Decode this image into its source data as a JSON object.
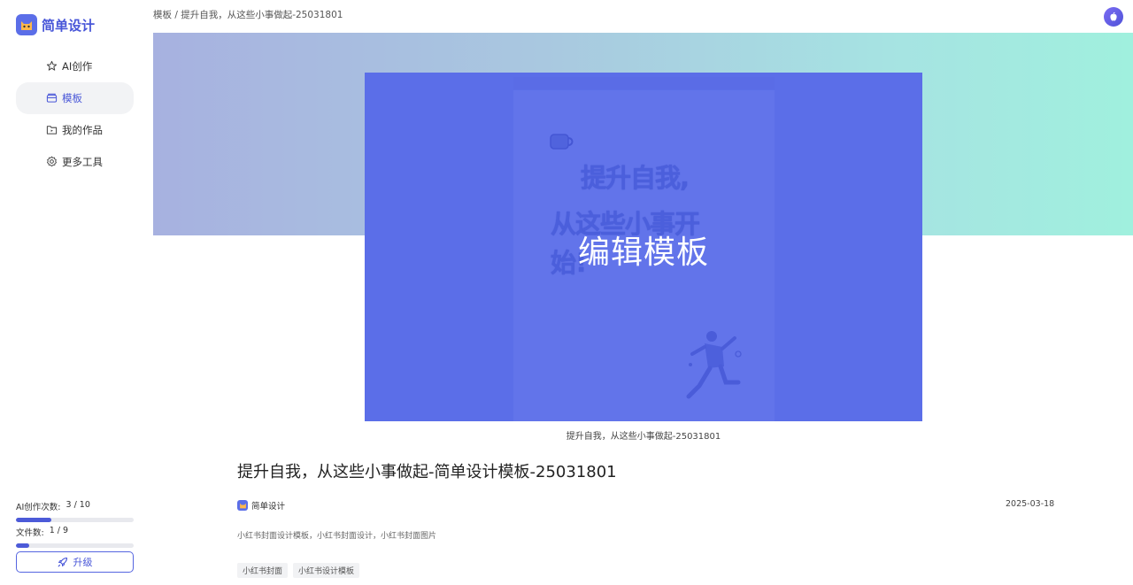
{
  "app": {
    "name": "简单设计"
  },
  "sidebar": {
    "items": [
      {
        "label": "AI创作",
        "icon": "star-icon",
        "active": false
      },
      {
        "label": "模板",
        "icon": "template-icon",
        "active": true
      },
      {
        "label": "我的作品",
        "icon": "folder-icon",
        "active": false
      },
      {
        "label": "更多工具",
        "icon": "gear-icon",
        "active": false
      }
    ],
    "quota": {
      "ai_label": "AI创作次数:",
      "ai_value": "3 / 10",
      "ai_fraction": 0.3,
      "file_label": "文件数:",
      "file_value": "1 / 9",
      "file_fraction": 0.111
    },
    "upgrade_label": "升级"
  },
  "header": {
    "breadcrumb": "模板 / 提升自我，从这些小事做起-25031801"
  },
  "preview": {
    "title_lines": [
      "提升自我,",
      "从这些小事开",
      "始!"
    ],
    "overlay_label": "编辑模板",
    "caption": "提升自我，从这些小事做起-25031801"
  },
  "detail": {
    "title": "提升自我，从这些小事做起-简单设计模板-25031801",
    "author": "简单设计",
    "date": "2025-03-18",
    "description": "小红书封面设计模板，小红书封面设计，小红书封面图片",
    "tags": [
      "小红书封面",
      "小红书设计模板"
    ]
  },
  "colors": {
    "accent": "#4856d8",
    "overlay": "#5b6ee8"
  }
}
